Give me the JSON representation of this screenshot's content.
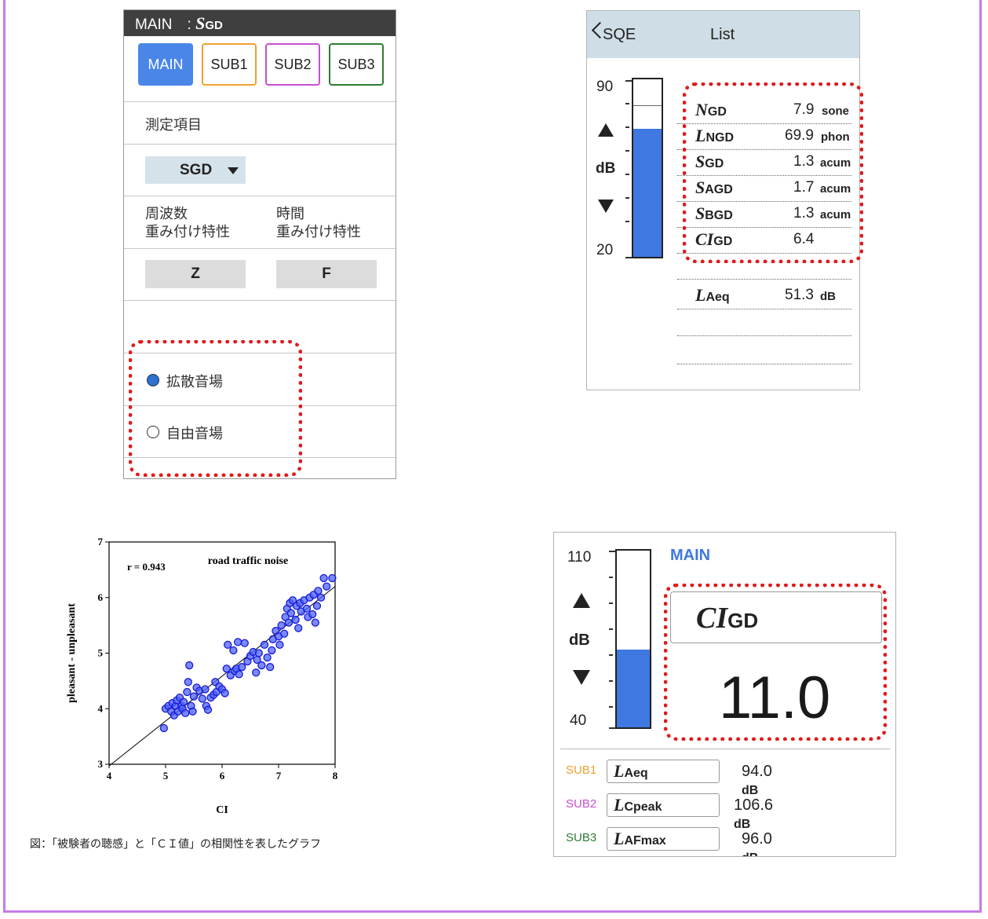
{
  "panel_main": {
    "header_prefix": "MAIN　: ",
    "header_symbol": "S",
    "header_sub": "GD",
    "tabs": [
      {
        "label": "MAIN",
        "color": "#4a86e8"
      },
      {
        "label": "SUB1",
        "color": "#f0a030"
      },
      {
        "label": "SUB2",
        "color": "#c84fd0"
      },
      {
        "label": "SUB3",
        "color": "#2e7d32"
      }
    ],
    "measurement_item_label": "測定項目",
    "measurement_dropdown_value": "SGD",
    "freq_weight_label_1": "周波数",
    "freq_weight_label_2": "重み付け特性",
    "time_weight_label_1": "時間",
    "time_weight_label_2": "重み付け特性",
    "freq_weight_value": "Z",
    "time_weight_value": "F",
    "sound_field_options": [
      {
        "label": "拡散音場",
        "selected": true
      },
      {
        "label": "自由音場",
        "selected": false
      }
    ]
  },
  "panel_list": {
    "back_label": "SQE",
    "title": "List",
    "scale_top": "90",
    "scale_bottom": "20",
    "unit_label": "dB",
    "meter_level": 0.72,
    "rows": [
      {
        "sym": "N",
        "sub": "GD",
        "value": "7.9",
        "unit": "sone"
      },
      {
        "sym": "L",
        "sub": "NGD",
        "value": "69.9",
        "unit": "phon"
      },
      {
        "sym": "S",
        "sub": "GD",
        "value": "1.3",
        "unit": "acum"
      },
      {
        "sym": "S",
        "sub": "AGD",
        "value": "1.7",
        "unit": "acum"
      },
      {
        "sym": "S",
        "sub": "BGD",
        "value": "1.3",
        "unit": "acum"
      },
      {
        "sym": "CI",
        "sub": "GD",
        "value": "6.4",
        "unit": ""
      }
    ],
    "laeq": {
      "sym": "L",
      "sub": "Aeq",
      "value": "51.3",
      "unit": "dB"
    }
  },
  "chart_data": {
    "type": "scatter",
    "title": "road traffic noise",
    "annotation": "r = 0.943",
    "xlabel": "CI",
    "ylabel": "pleasant - unpleasant",
    "xlim": [
      4,
      8
    ],
    "ylim": [
      3,
      7
    ],
    "xticks": [
      "4",
      "5",
      "6",
      "7",
      "8"
    ],
    "yticks": [
      "3",
      "4",
      "5",
      "6",
      "7"
    ],
    "grid": false,
    "regression_line": [
      [
        4.0,
        2.97
      ],
      [
        8.0,
        6.2
      ]
    ],
    "points": [
      [
        4.97,
        3.65
      ],
      [
        5.0,
        4.0
      ],
      [
        5.05,
        4.05
      ],
      [
        5.1,
        3.95
      ],
      [
        5.12,
        4.1
      ],
      [
        5.15,
        3.88
      ],
      [
        5.18,
        4.05
      ],
      [
        5.2,
        4.15
      ],
      [
        5.22,
        3.95
      ],
      [
        5.25,
        4.2
      ],
      [
        5.28,
        4.05
      ],
      [
        5.3,
        4.0
      ],
      [
        5.32,
        4.12
      ],
      [
        5.35,
        3.92
      ],
      [
        5.38,
        4.3
      ],
      [
        5.4,
        4.48
      ],
      [
        5.42,
        4.78
      ],
      [
        5.45,
        4.05
      ],
      [
        5.48,
        3.95
      ],
      [
        5.5,
        4.22
      ],
      [
        5.55,
        4.38
      ],
      [
        5.6,
        4.32
      ],
      [
        5.65,
        4.18
      ],
      [
        5.7,
        4.35
      ],
      [
        5.72,
        4.05
      ],
      [
        5.75,
        3.98
      ],
      [
        5.8,
        4.2
      ],
      [
        5.85,
        4.25
      ],
      [
        5.88,
        4.48
      ],
      [
        5.9,
        4.3
      ],
      [
        5.95,
        4.4
      ],
      [
        6.0,
        4.35
      ],
      [
        6.05,
        4.28
      ],
      [
        6.08,
        4.72
      ],
      [
        6.1,
        5.15
      ],
      [
        6.15,
        4.6
      ],
      [
        6.2,
        5.05
      ],
      [
        6.22,
        4.68
      ],
      [
        6.25,
        4.72
      ],
      [
        6.28,
        5.2
      ],
      [
        6.3,
        4.62
      ],
      [
        6.35,
        4.75
      ],
      [
        6.4,
        5.18
      ],
      [
        6.45,
        4.85
      ],
      [
        6.5,
        4.95
      ],
      [
        6.55,
        5.02
      ],
      [
        6.6,
        4.65
      ],
      [
        6.62,
        4.88
      ],
      [
        6.65,
        5.0
      ],
      [
        6.7,
        4.78
      ],
      [
        6.75,
        5.15
      ],
      [
        6.8,
        4.92
      ],
      [
        6.85,
        4.75
      ],
      [
        6.88,
        5.05
      ],
      [
        6.9,
        5.25
      ],
      [
        6.95,
        5.4
      ],
      [
        7.0,
        5.3
      ],
      [
        7.02,
        5.15
      ],
      [
        7.05,
        5.5
      ],
      [
        7.1,
        5.35
      ],
      [
        7.12,
        5.65
      ],
      [
        7.15,
        5.8
      ],
      [
        7.18,
        5.55
      ],
      [
        7.2,
        5.9
      ],
      [
        7.22,
        5.72
      ],
      [
        7.25,
        5.95
      ],
      [
        7.3,
        5.6
      ],
      [
        7.32,
        5.85
      ],
      [
        7.35,
        5.45
      ],
      [
        7.38,
        5.9
      ],
      [
        7.4,
        5.75
      ],
      [
        7.45,
        5.95
      ],
      [
        7.5,
        5.8
      ],
      [
        7.52,
        5.65
      ],
      [
        7.55,
        6.0
      ],
      [
        7.6,
        5.7
      ],
      [
        7.62,
        6.05
      ],
      [
        7.65,
        5.55
      ],
      [
        7.68,
        5.85
      ],
      [
        7.7,
        6.12
      ],
      [
        7.75,
        6.0
      ],
      [
        7.8,
        6.35
      ],
      [
        7.85,
        6.2
      ],
      [
        7.95,
        6.35
      ]
    ]
  },
  "caption": "図：「被験者の聴感」と「ＣＩ値」の相関性を表したグラフ",
  "panel_ci": {
    "scale_top": "110",
    "scale_bottom": "40",
    "unit_label": "dB",
    "meter_level": 0.44,
    "title": "MAIN",
    "metric_sym": "CI",
    "metric_sub": "GD",
    "big_value": "11.0",
    "subs": [
      {
        "label": "SUB1",
        "color": "#f0a030",
        "sym": "L",
        "sub": "Aeq",
        "value": "94.0",
        "unit": "dB"
      },
      {
        "label": "SUB2",
        "color": "#c84fd0",
        "sym": "L",
        "sub": "Cpeak",
        "value": "106.6",
        "unit": "dB"
      },
      {
        "label": "SUB3",
        "color": "#2e7d32",
        "sym": "L",
        "sub": "AFmax",
        "value": "96.0",
        "unit": "dB"
      }
    ]
  },
  "colors": {
    "accent_blue": "#3e78e0",
    "highlight_red": "#e01b1b",
    "frame_purple": "#c77be8",
    "point_blue": "#1a1ad0"
  }
}
